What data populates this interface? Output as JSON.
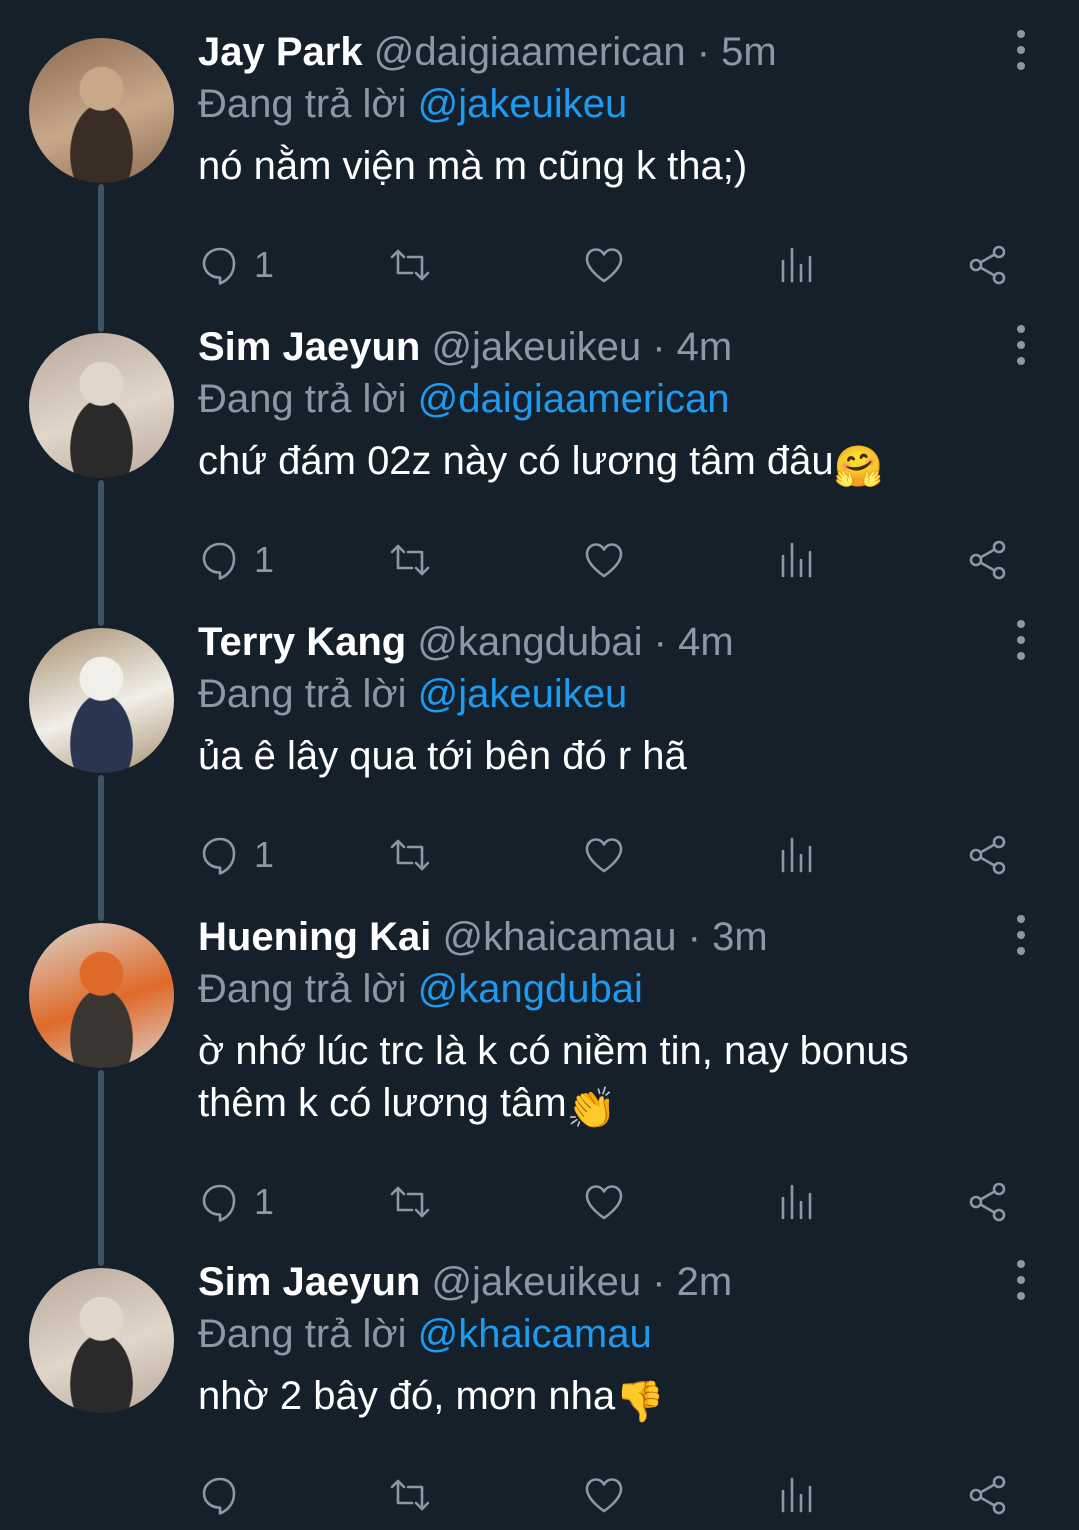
{
  "tweets": [
    {
      "name": "Jay Park",
      "handle": "@daigiaamerican",
      "time": "· 5m",
      "reply_prefix": "Đang trả lời",
      "reply_to": "@jakeuikeu",
      "text": "nó nằm viện mà m cũng k tha;)",
      "text2": "",
      "emoji": "",
      "reply_count": "1",
      "avatar_colors": [
        "#8b6b52",
        "#c9a88a",
        "#3a2d25"
      ]
    },
    {
      "name": "Sim Jaeyun",
      "handle": "@jakeuikeu",
      "time": "· 4m",
      "reply_prefix": "Đang trả lời",
      "reply_to": "@daigiaamerican",
      "text": "chứ đám 02z này có lương tâm đâu",
      "text2": "",
      "emoji": "🤗",
      "reply_count": "1",
      "avatar_colors": [
        "#b8a89a",
        "#e1d6ca",
        "#2a2a2a"
      ]
    },
    {
      "name": "Terry Kang",
      "handle": "@kangdubai",
      "time": "· 4m",
      "reply_prefix": "Đang trả lời",
      "reply_to": "@jakeuikeu",
      "text": "ủa ê lây qua tới bên đó r hã",
      "text2": "",
      "emoji": "",
      "reply_count": "1",
      "avatar_colors": [
        "#a89070",
        "#f1efe9",
        "#2a3550"
      ]
    },
    {
      "name": "Huening Kai",
      "handle": "@khaicamau",
      "time": "· 3m",
      "reply_prefix": "Đang trả lời",
      "reply_to": "@kangdubai",
      "text": "ờ nhớ lúc trc là k có niềm tin, nay bonus",
      "text2": "thêm k có lương tâm",
      "emoji": "👏",
      "reply_count": "1",
      "avatar_colors": [
        "#d9d4cc",
        "#e06a2a",
        "#3a3530"
      ]
    },
    {
      "name": "Sim Jaeyun",
      "handle": "@jakeuikeu",
      "time": "· 2m",
      "reply_prefix": "Đang trả lời",
      "reply_to": "@khaicamau",
      "text": "nhờ 2 bây đó, mơn nha",
      "text2": "",
      "emoji": "👎",
      "reply_count": "",
      "avatar_colors": [
        "#b8a89a",
        "#e1d6ca",
        "#2a2a2a"
      ]
    }
  ],
  "theme": {
    "background": "#15202b",
    "accent": "#1d9bf0",
    "muted": "#8b98a5",
    "thread_line": "#3d5466"
  },
  "icons": [
    "reply-icon",
    "retweet-icon",
    "like-icon",
    "views-icon",
    "share-icon",
    "more-icon"
  ]
}
